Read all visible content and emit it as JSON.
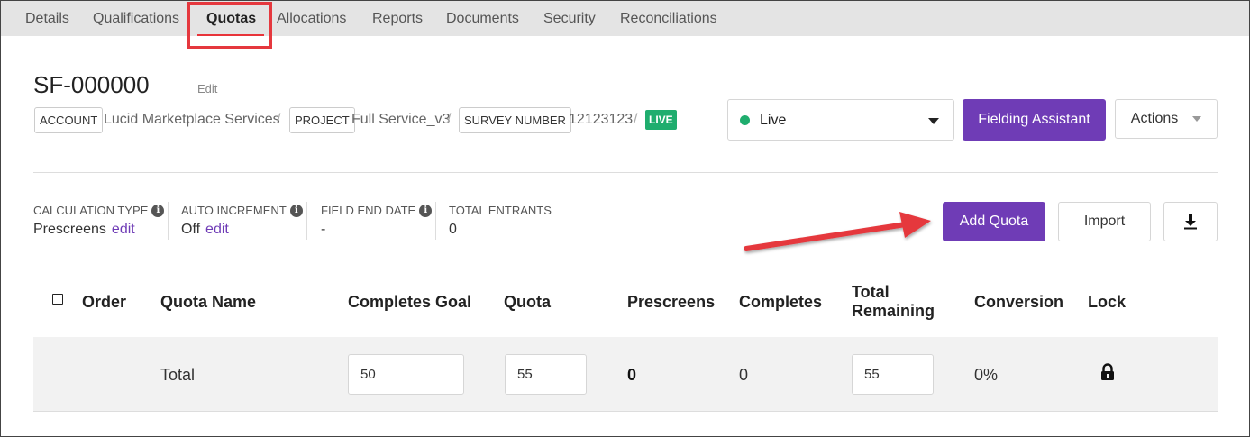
{
  "tabs": [
    {
      "label": "Details",
      "active": false
    },
    {
      "label": "Qualifications",
      "active": false
    },
    {
      "label": "Quotas",
      "active": true
    },
    {
      "label": "Allocations",
      "active": false
    },
    {
      "label": "Reports",
      "active": false
    },
    {
      "label": "Documents",
      "active": false
    },
    {
      "label": "Security",
      "active": false
    },
    {
      "label": "Reconciliations",
      "active": false
    }
  ],
  "header": {
    "survey_id": "SF-000000",
    "edit_label": "Edit",
    "breadcrumb": {
      "account_tag": "ACCOUNT",
      "account_value": "Lucid Marketplace Services",
      "project_tag": "PROJECT",
      "project_value": "Full Service_v3",
      "survey_number_tag": "SURVEY NUMBER",
      "survey_number_value": "12123123",
      "separator": "/",
      "live_badge": "LIVE"
    },
    "status_select": {
      "value": "Live",
      "dot_color": "#1fad6e"
    },
    "fielding_assistant_label": "Fielding Assistant",
    "actions_label": "Actions"
  },
  "info": {
    "calculation_type": {
      "label": "CALCULATION TYPE",
      "value": "Prescreens",
      "edit": "edit"
    },
    "auto_increment": {
      "label": "AUTO INCREMENT",
      "value": "Off",
      "edit": "edit"
    },
    "field_end_date": {
      "label": "FIELD END DATE",
      "value": "-"
    },
    "total_entrants": {
      "label": "TOTAL ENTRANTS",
      "value": "0"
    }
  },
  "buttons": {
    "add_quota": "Add Quota",
    "import": "Import",
    "download_icon": "download-icon"
  },
  "table": {
    "columns": [
      "Order",
      "Quota Name",
      "Completes Goal",
      "Quota",
      "Prescreens",
      "Completes",
      "Total Remaining",
      "Conversion",
      "Lock"
    ],
    "total_row": {
      "name": "Total",
      "completes_goal": "50",
      "quota": "55",
      "prescreens": "0",
      "completes": "0",
      "total_remaining": "55",
      "conversion": "0%",
      "lock_icon": "lock-icon"
    }
  },
  "colors": {
    "accent_purple": "#6f3cb6",
    "live_green": "#1fad6e",
    "highlight_red": "#e5383e"
  }
}
